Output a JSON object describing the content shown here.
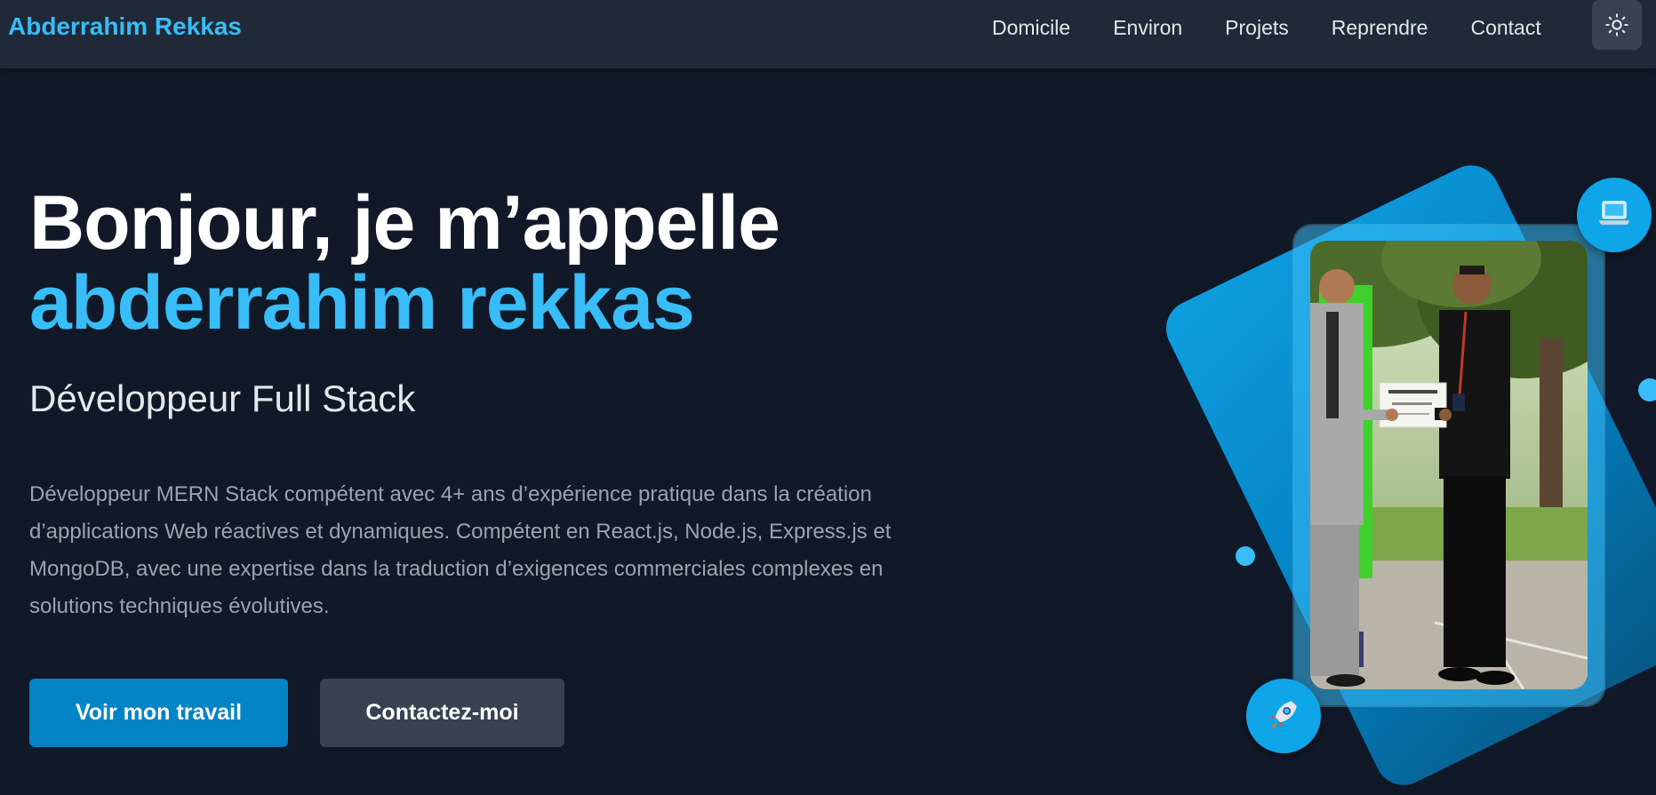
{
  "header": {
    "brand": "Abderrahim Rekkas",
    "nav": [
      "Domicile",
      "Environ",
      "Projets",
      "Reprendre",
      "Contact"
    ],
    "theme_toggle_icon": "sun-icon"
  },
  "hero": {
    "greeting": "Bonjour, je m’appelle",
    "name": "abderrahim rekkas",
    "role": "Développeur Full Stack",
    "description": "Développeur MERN Stack compétent avec 4+ ans d’expérience pratique dans la création d’applications Web réactives et dynamiques. Compétent en React.js, Node.js, Express.js et MongoDB, avec une expertise dans la traduction d’exigences commerciales complexes en solutions techniques évolutives.",
    "primary_button": "Voir mon travail",
    "secondary_button": "Contactez-moi"
  },
  "visual": {
    "photo_icon": "portrait-photo",
    "top_badge_icon": "laptop-icon",
    "bottom_badge_icon": "rocket-icon"
  },
  "colors": {
    "background": "#111827",
    "navbar": "#1f2937",
    "accent": "#38bdf8",
    "primary_button": "#0284c7",
    "secondary_button": "#374151"
  }
}
